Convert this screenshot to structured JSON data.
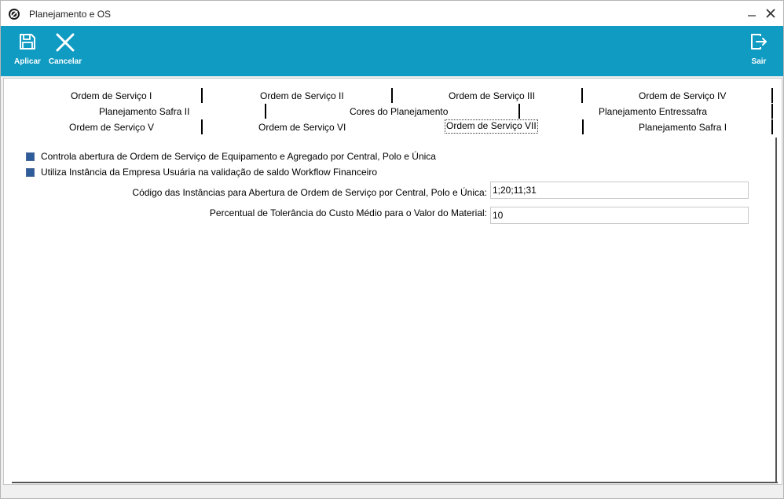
{
  "window": {
    "title": "Planejamento e OS",
    "icon": "app-logo-icon",
    "minimize_icon": "minimize-icon",
    "close_icon": "close-icon"
  },
  "toolbar": {
    "apply_label": "Aplicar",
    "cancel_label": "Cancelar",
    "exit_label": "Sair",
    "background_color": "#0f9bc2"
  },
  "tabs": {
    "row1": [
      "Ordem de Serviço I",
      "Ordem de Serviço II",
      "Ordem de Serviço III",
      "Ordem de Serviço IV"
    ],
    "row2": [
      "Planejamento Safra II",
      "Cores do Planejamento",
      "Planejamento Entressafra"
    ],
    "row3": [
      "Ordem de Serviço V",
      "Ordem de Serviço VI",
      "Ordem de Serviço VII",
      "Planejamento Safra I"
    ],
    "selected": "Ordem de Serviço VII"
  },
  "form": {
    "checkbox1_label": "Controla abertura de Ordem de Serviço de Equipamento e Agregado por Central, Polo e Única",
    "checkbox1_checked": true,
    "checkbox2_label": "Utiliza Instância da Empresa Usuária na validação de saldo Workflow Financeiro",
    "checkbox2_checked": true,
    "field1_label": "Código das Instâncias para Abertura de Ordem de Serviço  por Central, Polo e Única:",
    "field1_value": "1;20;11;31",
    "field2_label": "Percentual de Tolerância do Custo Médio para o Valor do Material:",
    "field2_value": "10"
  }
}
